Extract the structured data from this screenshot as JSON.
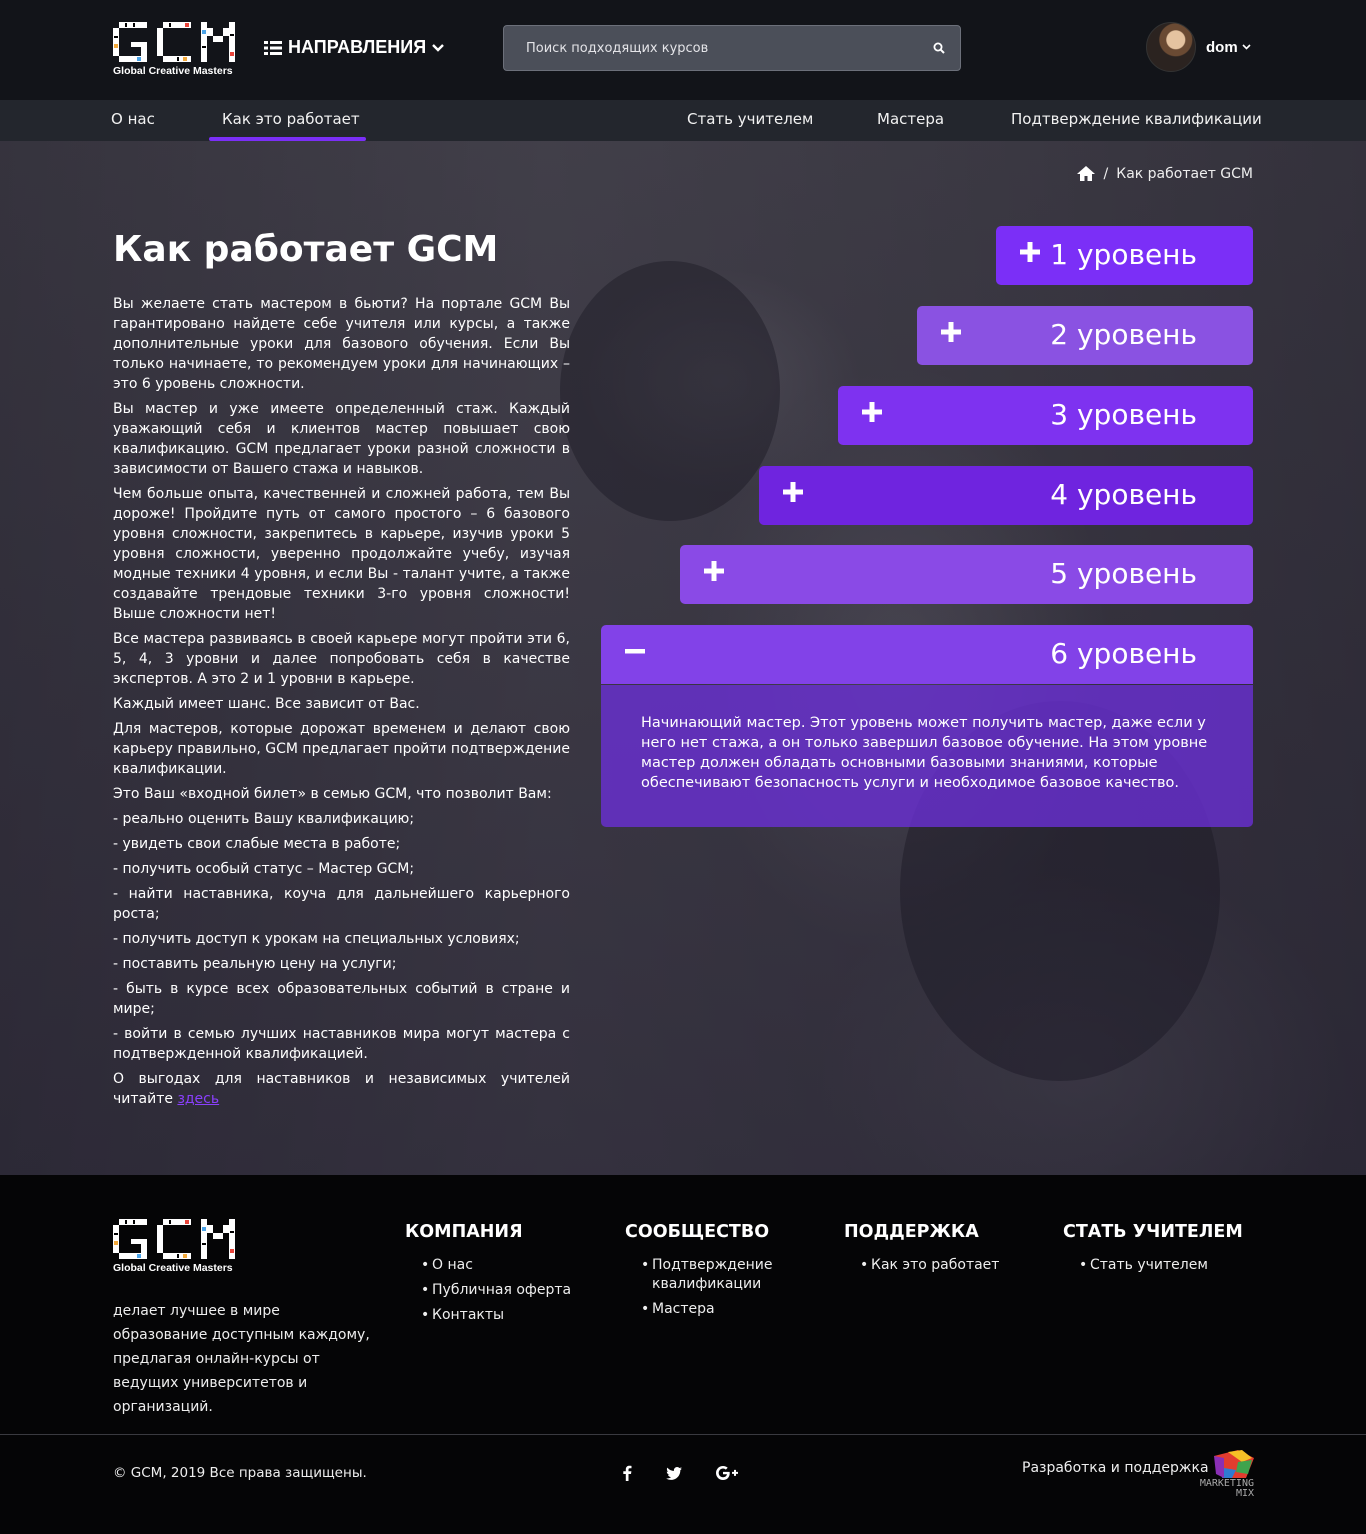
{
  "brand": {
    "logo_text": "GCM",
    "subtitle": "Global Creative Masters",
    "accent_color": "#7b2ff7"
  },
  "header": {
    "directions_label": "НАПРАВЛЕНИЯ",
    "directions_icon": "list-icon",
    "search_placeholder": "Поиск подходящих курсов",
    "search_icon": "search-icon",
    "user_name": "dom"
  },
  "nav": {
    "items": [
      {
        "label": "О нас"
      },
      {
        "label": "Как это работает",
        "active": true
      },
      {
        "label": "Стать учителем"
      },
      {
        "label": "Мастера"
      },
      {
        "label": "Подтверждение квалификации"
      }
    ]
  },
  "breadcrumb": {
    "home_icon": "home-icon",
    "separator": "/",
    "current": "Как работает GCM"
  },
  "main": {
    "title": "Как работает GCM",
    "paragraphs": [
      "Вы желаете стать мастером в бьюти? На портале GCM Вы гарантировано найдете себе учителя или курсы, а также дополнительные уроки для базового обучения. Если Вы только начинаете, то рекомендуем уроки для начинающих – это 6 уровень сложности.",
      "Вы мастер и уже имеете определенный стаж. Каждый уважающий себя и клиентов мастер повышает свою квалификацию. GCM предлагает уроки разной сложности в зависимости от Вашего стажа и навыков.",
      "Чем больше опыта, качественней и сложней работа, тем Вы дороже! Пройдите путь от самого простого – 6 базового уровня сложности, закрепитесь в карьере, изучив уроки 5 уровня сложности, уверенно продолжайте учебу, изучая модные техники 4 уровня, и если Вы - талант учите, а также создавайте трендовые техники 3-го уровня сложности! Выше сложности нет!",
      "Все мастера развиваясь в своей карьере могут пройти эти 6, 5, 4, 3 уровни и далее попробовать себя в качестве экспертов. А это 2 и 1 уровни в карьере.",
      "Каждый имеет шанс. Все зависит от Вас.",
      "Для мастеров, которые дорожат временем и делают свою карьеру правильно, GCM предлагает пройти подтверждение квалификации.",
      "Это Ваш «входной билет» в семью GCM, что позволит Вам:",
      "- реально оценить Вашу квалификацию;",
      "- увидеть свои слабые места в работе;",
      "- получить особый статус – Мастер GCM;",
      "- найти наставника, коуча для дальнейшего карьерного роста;",
      "- получить доступ к урокам на специальных условиях;",
      "- поставить реальную цену на услуги;",
      "- быть в курсе всех образовательных событий в стране и мире;",
      "- войти в семью лучших наставников мира могут мастера с подтвержденной квалификацией."
    ],
    "last_paragraph": "О выгодах для наставников и независимых учителей читайте",
    "link_text": "здесь"
  },
  "levels": [
    {
      "label": "1 уровень",
      "sign": "plus-icon",
      "color": "#7b2ff7"
    },
    {
      "label": "2 уровень",
      "sign": "plus-icon",
      "color": "#8a52e2"
    },
    {
      "label": "3 уровень",
      "sign": "plus-icon",
      "color": "#7e32f0"
    },
    {
      "label": "4 уровень",
      "sign": "plus-icon",
      "color": "#6f24df"
    },
    {
      "label": "5 уровень",
      "sign": "plus-icon",
      "color": "#8a4ae6"
    },
    {
      "label": "6 уровень",
      "sign": "minus-icon",
      "color": "#8242e8",
      "expanded": true
    }
  ],
  "level_description": "Начинающий мастер. Этот уровень может получить мастер, даже если у него нет стажа, а он только завершил базовое обучение. На этом уровне мастер должен обладать основными базовыми знаниями, которые обеспечивают безопасность услуги и необходимое базовое качество.",
  "footer": {
    "description": "делает лучшее в мире образование доступным каждому, предлагая онлайн-курсы от ведущих университетов и организаций.",
    "columns": [
      {
        "title": "КОМПАНИЯ",
        "links": [
          "О нас",
          "Публичная оферта",
          "Контакты"
        ]
      },
      {
        "title": "СООБЩЕСТВО",
        "links": [
          "Подтверждение квалификации",
          "Мастера"
        ]
      },
      {
        "title": "ПОДДЕРЖКА",
        "links": [
          "Как это работает"
        ]
      },
      {
        "title": "СТАТЬ УЧИТЕЛЕМ",
        "links": [
          "Стать учителем"
        ]
      }
    ],
    "copyright": "© GCM, 2019 Все права защищены.",
    "socials": [
      "facebook-icon",
      "twitter-icon",
      "google-plus-icon"
    ],
    "developer_label": "Разработка и поддержка",
    "developer_logo_text": "MARKETING MIX"
  }
}
